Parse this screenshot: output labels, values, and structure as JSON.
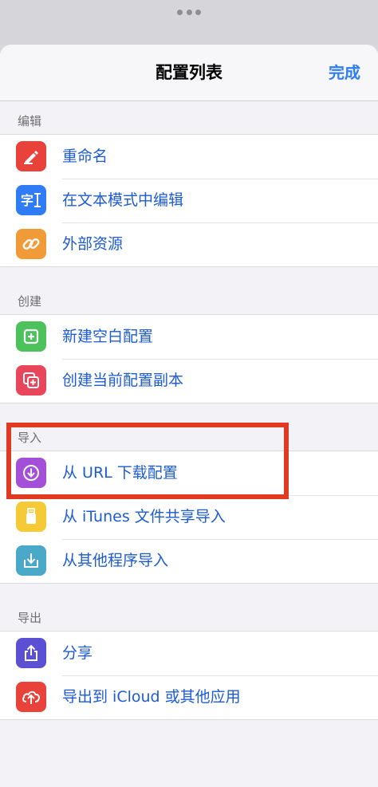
{
  "nav": {
    "title": "配置列表",
    "done_label": "完成"
  },
  "sections": [
    {
      "header": "编辑",
      "items": [
        {
          "label": "重命名",
          "icon": "rename-pencil-icon",
          "color": "#e8423a"
        },
        {
          "label": "在文本模式中编辑",
          "icon": "text-cursor-icon",
          "color": "#2f7cf6"
        },
        {
          "label": "外部资源",
          "icon": "link-icon",
          "color": "#f19a38"
        }
      ]
    },
    {
      "header": "创建",
      "items": [
        {
          "label": "新建空白配置",
          "icon": "plus-square-icon",
          "color": "#4cc25c"
        },
        {
          "label": "创建当前配置副本",
          "icon": "duplicate-icon",
          "color": "#e8465a"
        }
      ]
    },
    {
      "header": "导入",
      "items": [
        {
          "label": "从 URL 下载配置",
          "icon": "download-circle-icon",
          "color": "#a34fd8"
        },
        {
          "label": "从 iTunes 文件共享导入",
          "icon": "usb-drive-icon",
          "color": "#f6c936"
        },
        {
          "label": "从其他程序导入",
          "icon": "import-tray-icon",
          "color": "#4aa9c9"
        }
      ]
    },
    {
      "header": "导出",
      "items": [
        {
          "label": "分享",
          "icon": "share-icon",
          "color": "#5b4fd4"
        },
        {
          "label": "导出到 iCloud 或其他应用",
          "icon": "cloud-upload-icon",
          "color": "#e8423a"
        }
      ]
    }
  ],
  "highlight_color": "#e03a23"
}
